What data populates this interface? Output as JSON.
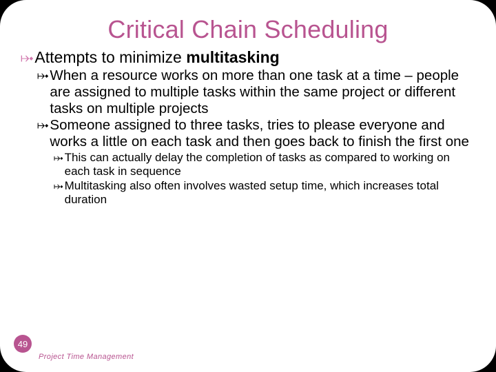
{
  "title": "Critical Chain Scheduling",
  "bullet_glyph": "⤠",
  "level1": {
    "text_before_bold": "Attempts to minimize ",
    "bold": "multitasking"
  },
  "level2": {
    "item1": "When a resource works on more than one task at a time – people are  assigned to multiple tasks within the same project or different tasks on multiple projects",
    "item2": "Someone assigned to three tasks, tries to please everyone and works a little on each task and then goes back to finish the first one"
  },
  "level3": {
    "item1": "This can actually delay the completion of tasks as compared to working on each task in sequence",
    "item2": "Multitasking also often involves wasted setup time, which increases total duration"
  },
  "footer": {
    "page_number": "49",
    "label": "Project Time Management"
  }
}
